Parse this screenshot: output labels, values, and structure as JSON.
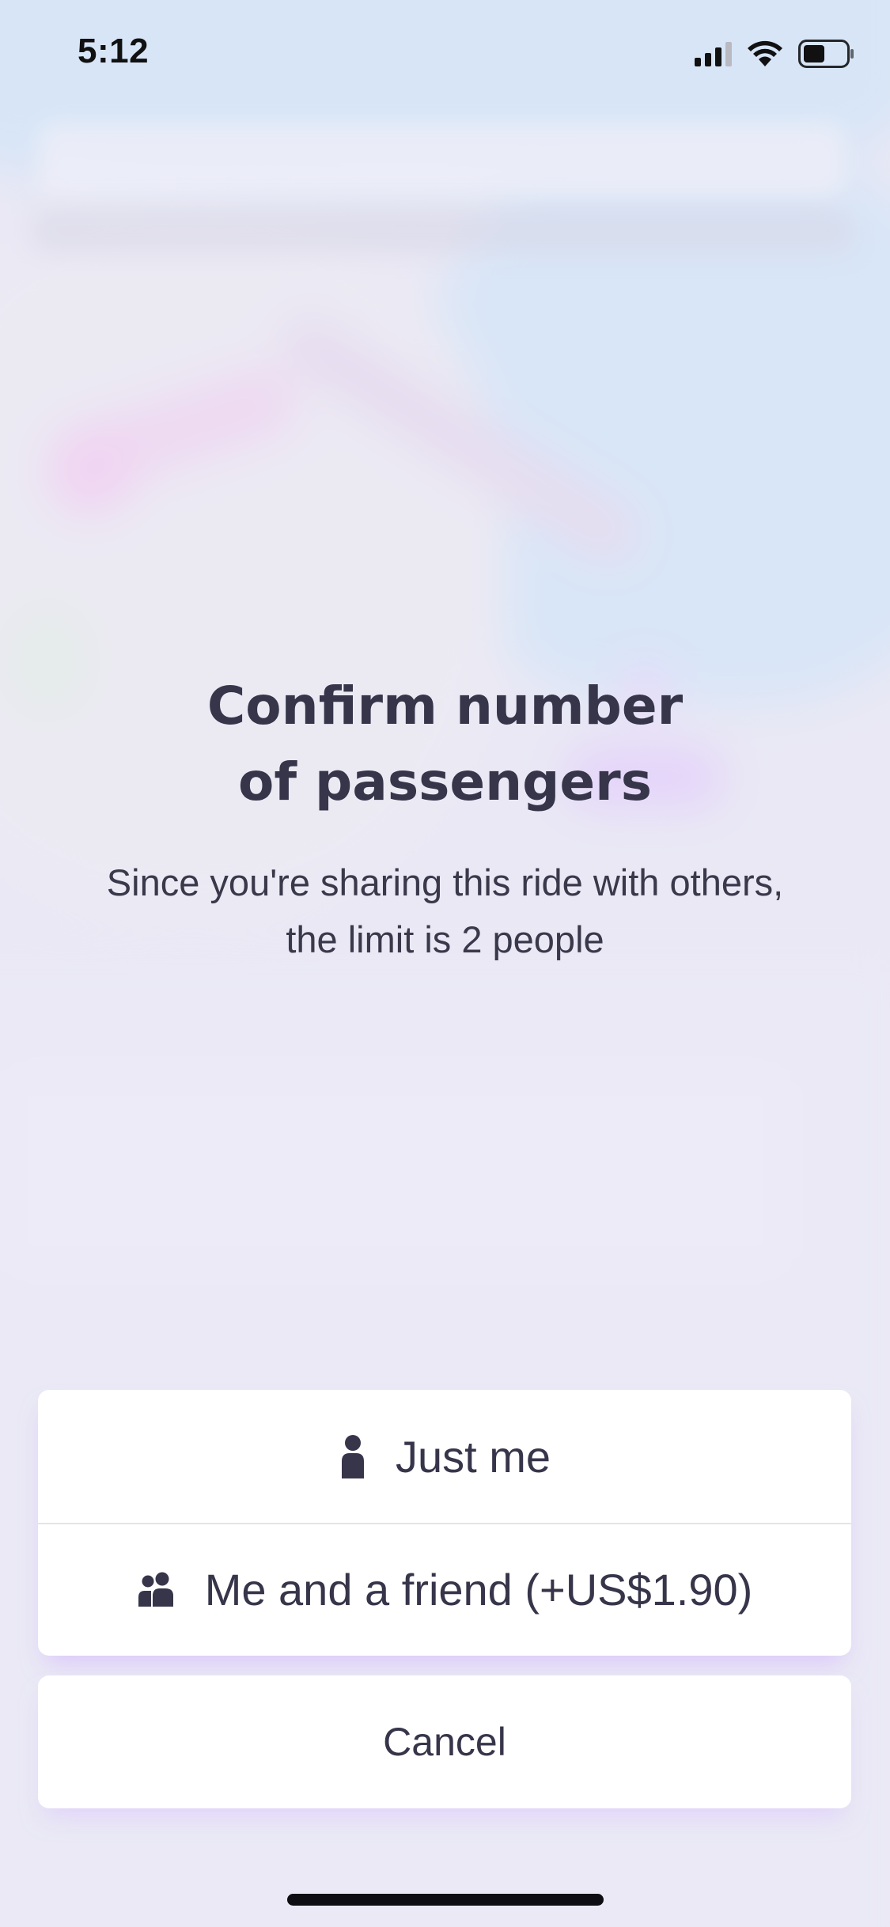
{
  "status_bar": {
    "time": "5:12",
    "icons": [
      "cellular-signal-icon",
      "wifi-icon",
      "battery-icon"
    ]
  },
  "dialog": {
    "title_lines": [
      "Confirm number",
      "of passengers"
    ],
    "description_lines": [
      "Since you're sharing this ride with others,",
      "the limit is 2 people"
    ]
  },
  "options": [
    {
      "label": "Just me",
      "icon": "single-person-icon"
    },
    {
      "label": "Me and a friend (+US$1.90)",
      "icon": "two-people-icon"
    }
  ],
  "cancel": {
    "label": "Cancel"
  },
  "colors": {
    "text": "#36354a",
    "accent_glow": "#dcb9ff",
    "overlay": "#ebeaf6"
  }
}
